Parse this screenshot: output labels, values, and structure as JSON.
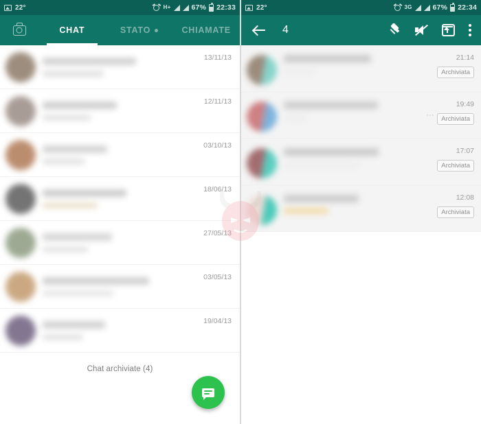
{
  "theme": {
    "teal": "#0f7567",
    "teal_dark": "#0c5f54",
    "fab_green": "#2dc14e",
    "muted_text": "#9b9b9b",
    "selected_row": "#f4f4f4"
  },
  "left_phone": {
    "status_bar": {
      "image_icon": "image-icon",
      "temperature": "22°",
      "alarm_icon": "alarm-icon",
      "network": "H+",
      "signal_icon": "signal-bars-icon",
      "battery_percent": "67%",
      "battery_icon": "battery-icon",
      "clock": "22:33"
    },
    "app_bar": {
      "camera_icon": "camera-icon",
      "tabs": [
        {
          "label": "CHAT",
          "active": true,
          "dot": false
        },
        {
          "label": "STATO",
          "active": false,
          "dot": true
        },
        {
          "label": "CHIAMATE",
          "active": false,
          "dot": false
        }
      ]
    },
    "chat_rows": [
      {
        "date": "13/11/13",
        "avatar_color": "#8d7a68",
        "line1_color": "#d2d2d2",
        "line1_width": "58%",
        "line2_color": "#e0e0e0",
        "line2_width": "38%"
      },
      {
        "date": "12/11/13",
        "avatar_color": "#9a8b84",
        "line1_color": "#cfcfcf",
        "line1_width": "46%",
        "line2_color": "#e3e3e3",
        "line2_width": "30%"
      },
      {
        "date": "03/10/13",
        "avatar_color": "#b07a56",
        "line1_color": "#d4d4d4",
        "line1_width": "40%",
        "line2_color": "#e2e2e2",
        "line2_width": "26%"
      },
      {
        "date": "18/06/13",
        "avatar_color": "#5c5c5c",
        "line1_color": "#cdcdcd",
        "line1_width": "52%",
        "line2_color": "#ece3cf",
        "line2_width": "34%"
      },
      {
        "date": "27/05/13",
        "avatar_color": "#8c9b80",
        "line1_color": "#d6d6d6",
        "line1_width": "43%",
        "line2_color": "#e4e4e4",
        "line2_width": "28%"
      },
      {
        "date": "03/05/13",
        "avatar_color": "#c29a6d",
        "line1_color": "#d0d0d0",
        "line1_width": "66%",
        "line2_color": "#e6e6e6",
        "line2_width": "44%"
      },
      {
        "date": "19/04/13",
        "avatar_color": "#6d5f7e",
        "line1_color": "#d2d2d2",
        "line1_width": "39%",
        "line2_color": "#e3e3e3",
        "line2_width": "25%"
      }
    ],
    "archived_label": "Chat archiviate (4)",
    "fab": {
      "icon": "new-chat-icon",
      "label": "Nuova chat"
    }
  },
  "right_phone": {
    "status_bar": {
      "image_icon": "image-icon",
      "temperature": "22°",
      "alarm_icon": "alarm-icon",
      "network": "3G",
      "signal_icon": "signal-bars-icon",
      "battery_percent": "67%",
      "battery_icon": "battery-icon",
      "clock": "22:34"
    },
    "app_bar": {
      "back_icon": "back-arrow-icon",
      "selected_count": "4",
      "actions": [
        {
          "name": "pin-icon",
          "label": "Fissa in alto"
        },
        {
          "name": "mute-icon",
          "label": "Silenzia"
        },
        {
          "name": "unarchive-icon",
          "label": "Rimuovi dall'archivio"
        },
        {
          "name": "overflow-menu-icon",
          "label": "Altro"
        }
      ]
    },
    "selected_rows": [
      {
        "time": "21:14",
        "badge": "Archiviata",
        "avatar_color": "#8d7a68",
        "accent_color": "#74cfc4",
        "line1_color": "#cbcbcb",
        "line1_width": "58%",
        "line2_color": "#ededed",
        "line2_width": "20%",
        "ellipsis": ""
      },
      {
        "time": "19:49",
        "badge": "Archiviata",
        "avatar_color": "#c96d70",
        "accent_color": "#6aa8d8",
        "line1_color": "#cdcdcd",
        "line1_width": "66%",
        "line2_color": "#ededed",
        "line2_width": "16%",
        "ellipsis": "···"
      },
      {
        "time": "17:07",
        "badge": "Archiviata",
        "avatar_color": "#96565a",
        "accent_color": "#40c6b6",
        "line1_color": "#cacaca",
        "line1_width": "63%",
        "line2_color": "#eeeeee",
        "line2_width": "50%",
        "ellipsis": ""
      },
      {
        "time": "12:08",
        "badge": "Archiviata",
        "avatar_color": "#e9d6cf",
        "accent_color": "#2fc3b0",
        "line1_color": "#cccccc",
        "line1_width": "50%",
        "line2_color": "#f2ddab",
        "line2_width": "30%",
        "ellipsis": ""
      }
    ]
  },
  "watermark": {
    "name": "devil-face-watermark",
    "color": "#f2a0ab"
  }
}
